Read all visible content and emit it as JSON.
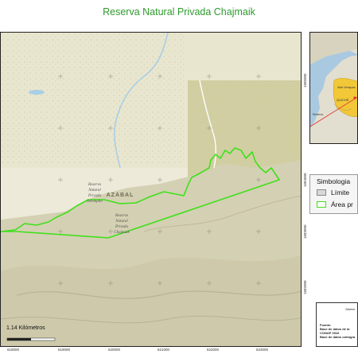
{
  "title": "Reserva Natural Privada Chajmaik",
  "map": {
    "x_ticks_top": [
      "618000",
      "619000",
      "620000",
      "621000",
      "622000",
      "623000"
    ],
    "x_ticks_bottom": [
      "618000",
      "619000",
      "620000",
      "621000",
      "622000",
      "623000"
    ],
    "y_ticks": [
      "1685000",
      "1684000",
      "1683000",
      "1682000"
    ],
    "labels": {
      "reserva_selempim": [
        "Reserva",
        "Natural",
        "Privada",
        "Selempim"
      ],
      "reserva_chajmaik": [
        "Reserva",
        "Natural",
        "Privada",
        "Chajmaik"
      ],
      "azabal": "AZABAL"
    },
    "scale_label": "1.14 Kilómetros",
    "colors": {
      "upland": "#dcd8c0",
      "lowland": "#eeead9",
      "boundary": "#3fe01a",
      "river": "#a7cfe6"
    }
  },
  "inset": {
    "labels": [
      "Alta Verapaz",
      "QUICHÉ"
    ],
    "marker": "Reserva"
  },
  "legend": {
    "title": "Simbologia",
    "items": [
      {
        "label": "Límite",
        "color": "#d9d9d9",
        "border": "#888888"
      },
      {
        "label": "Área pr",
        "color": "#ffffff",
        "border": "#3fe01a"
      }
    ]
  },
  "info": {
    "heading": "Sistem",
    "source_label": "Fuente:",
    "source_lines": [
      "Base de datos de la",
      "CONAP 2016",
      "Base de datos cartogra"
    ]
  }
}
